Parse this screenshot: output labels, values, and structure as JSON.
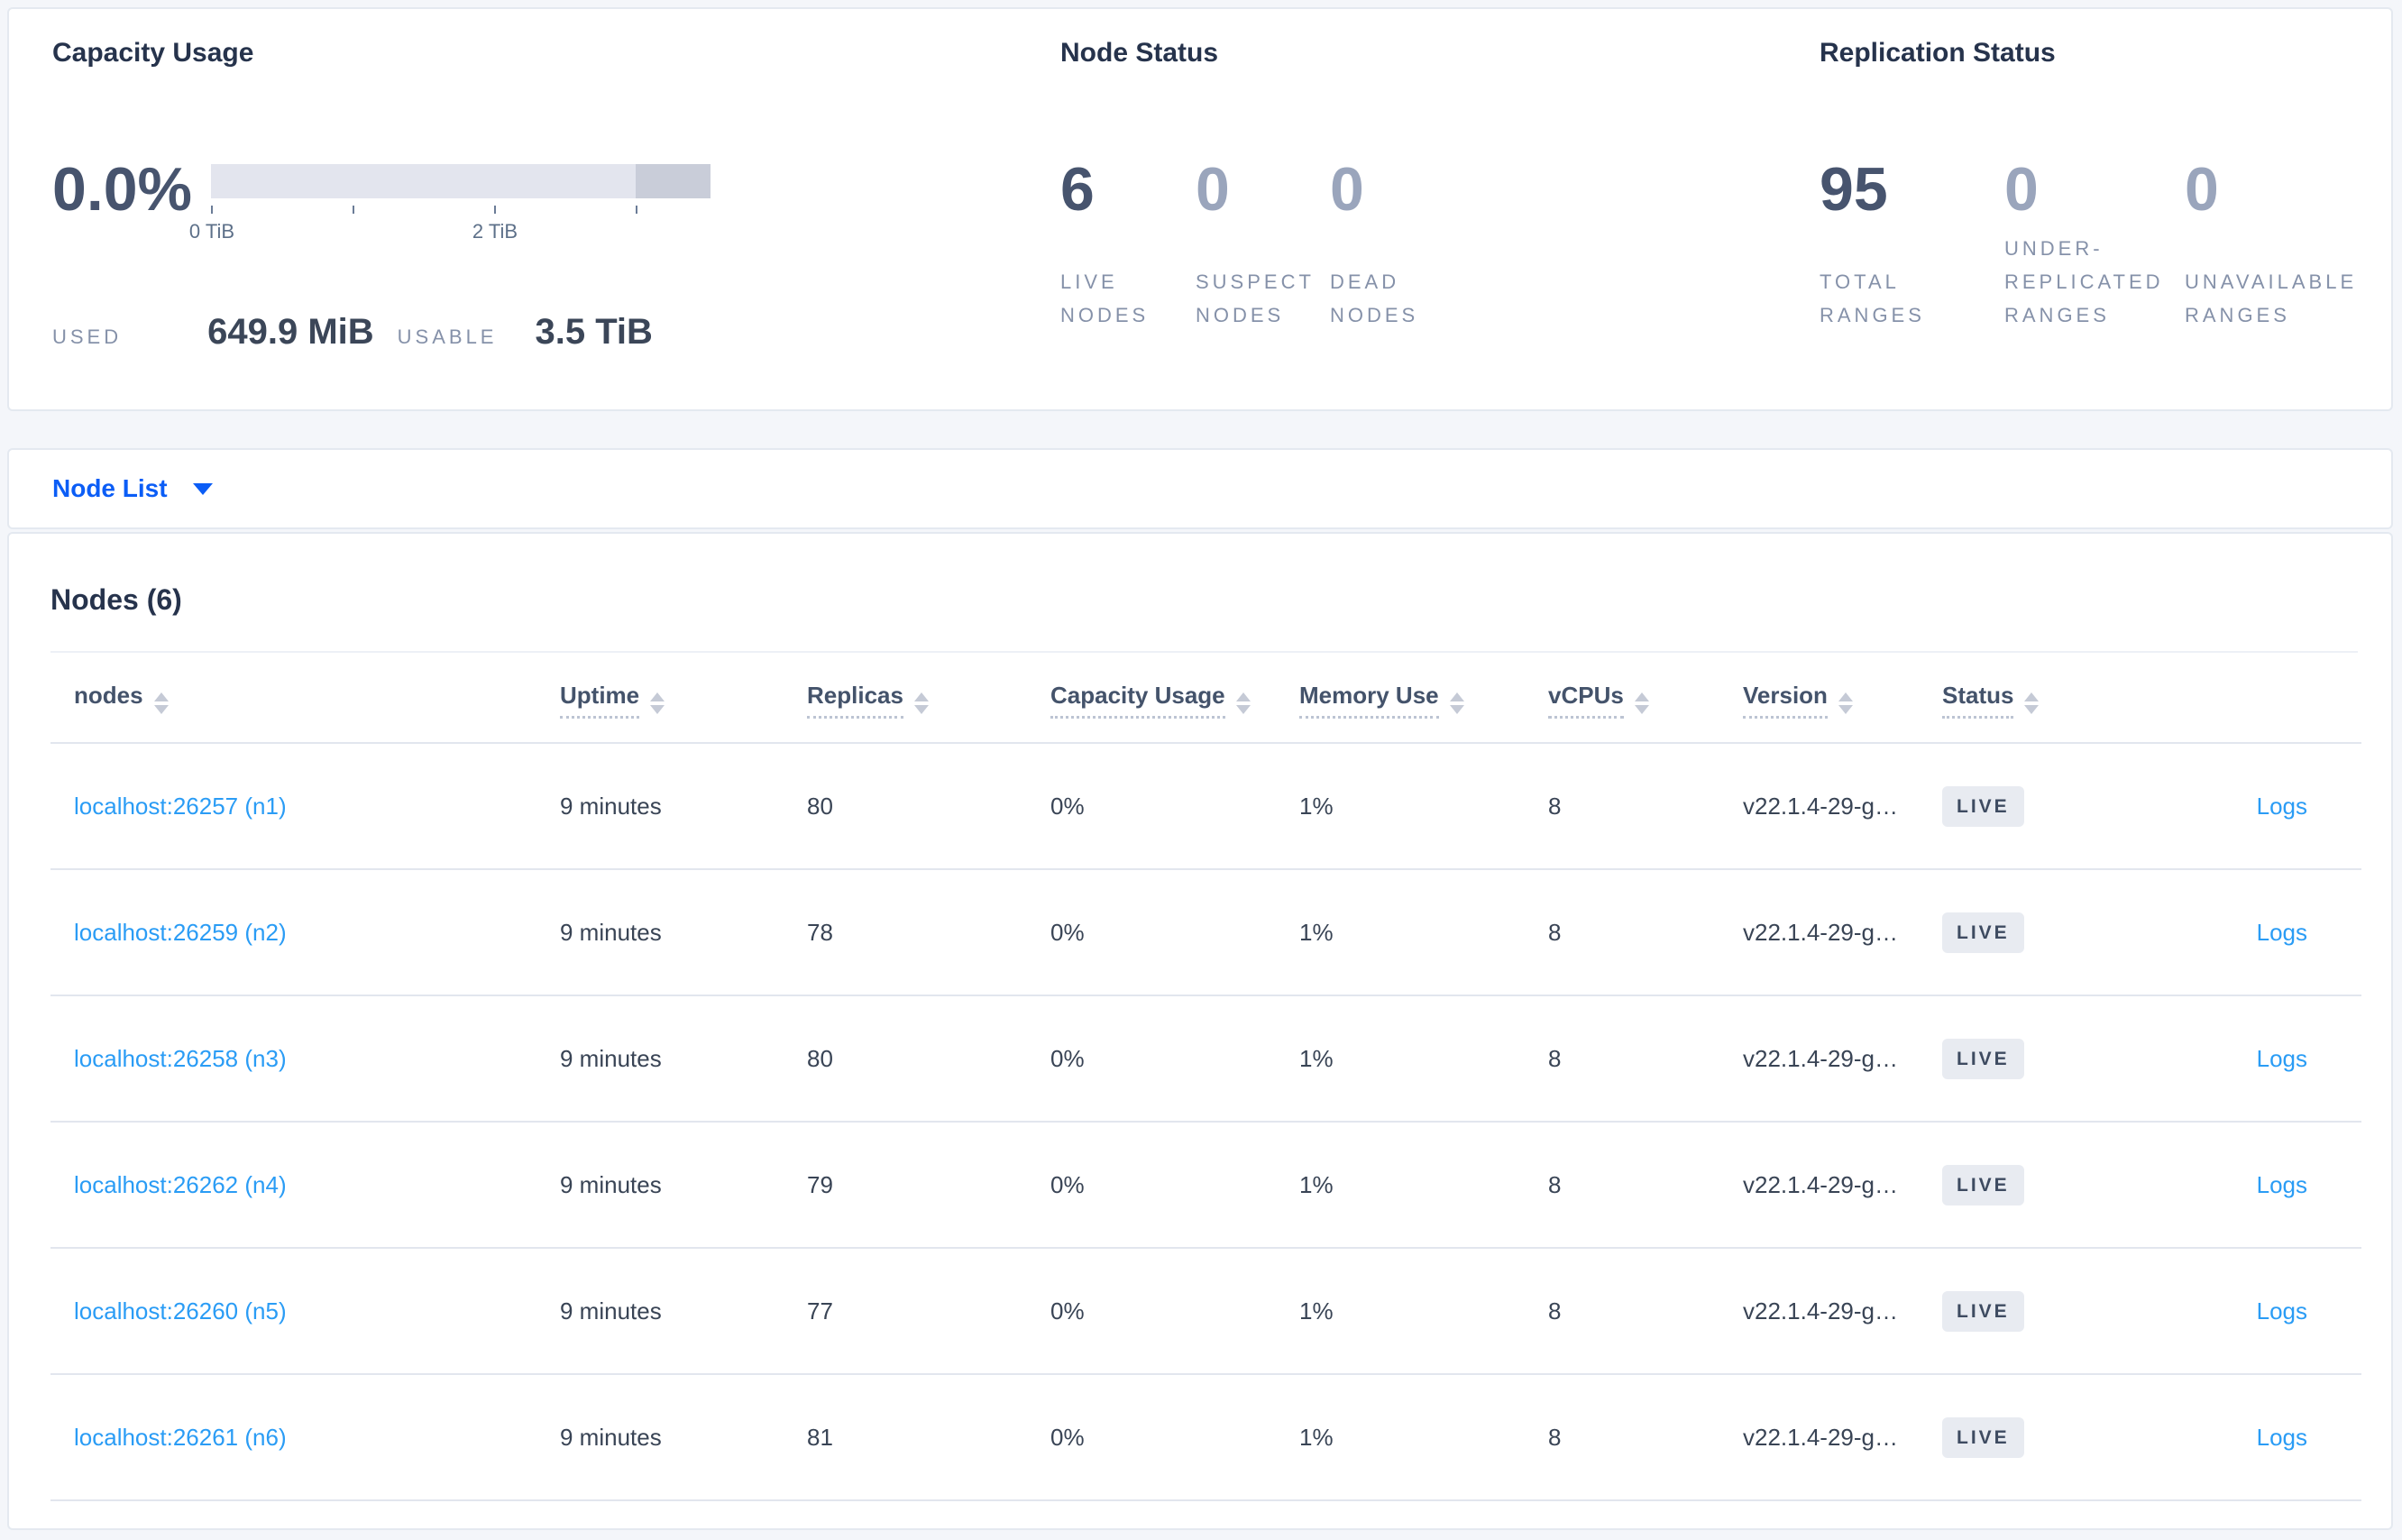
{
  "summary": {
    "capacity": {
      "title": "Capacity Usage",
      "percent": "0.0%",
      "axis_ticks": [
        "0 TiB",
        "2 TiB"
      ],
      "used_label": "USED",
      "used_value": "649.9 MiB",
      "usable_label": "USABLE",
      "usable_value": "3.5 TiB"
    },
    "node_status": {
      "title": "Node Status",
      "stats": [
        {
          "value": "6",
          "label": "LIVE NODES"
        },
        {
          "value": "0",
          "label": "SUSPECT NODES"
        },
        {
          "value": "0",
          "label": "DEAD NODES"
        }
      ]
    },
    "replication": {
      "title": "Replication Status",
      "stats": [
        {
          "value": "95",
          "label": "TOTAL RANGES"
        },
        {
          "value": "0",
          "label": "UNDER-REPLICATED RANGES"
        },
        {
          "value": "0",
          "label": "UNAVAILABLE RANGES"
        }
      ]
    }
  },
  "node_list": {
    "selector_label": "Node List"
  },
  "nodes_table": {
    "title": "Nodes (6)",
    "columns": [
      {
        "label": "nodes"
      },
      {
        "label": "Uptime"
      },
      {
        "label": "Replicas"
      },
      {
        "label": "Capacity Usage"
      },
      {
        "label": "Memory Use"
      },
      {
        "label": "vCPUs"
      },
      {
        "label": "Version"
      },
      {
        "label": "Status"
      }
    ],
    "rows": [
      {
        "node": "localhost:26257 (n1)",
        "uptime": "9 minutes",
        "replicas": "80",
        "capacity": "0%",
        "memory": "1%",
        "vcpus": "8",
        "version": "v22.1.4-29-g…",
        "status": "LIVE",
        "logs": "Logs"
      },
      {
        "node": "localhost:26259 (n2)",
        "uptime": "9 minutes",
        "replicas": "78",
        "capacity": "0%",
        "memory": "1%",
        "vcpus": "8",
        "version": "v22.1.4-29-g…",
        "status": "LIVE",
        "logs": "Logs"
      },
      {
        "node": "localhost:26258 (n3)",
        "uptime": "9 minutes",
        "replicas": "80",
        "capacity": "0%",
        "memory": "1%",
        "vcpus": "8",
        "version": "v22.1.4-29-g…",
        "status": "LIVE",
        "logs": "Logs"
      },
      {
        "node": "localhost:26262 (n4)",
        "uptime": "9 minutes",
        "replicas": "79",
        "capacity": "0%",
        "memory": "1%",
        "vcpus": "8",
        "version": "v22.1.4-29-g…",
        "status": "LIVE",
        "logs": "Logs"
      },
      {
        "node": "localhost:26260 (n5)",
        "uptime": "9 minutes",
        "replicas": "77",
        "capacity": "0%",
        "memory": "1%",
        "vcpus": "8",
        "version": "v22.1.4-29-g…",
        "status": "LIVE",
        "logs": "Logs"
      },
      {
        "node": "localhost:26261 (n6)",
        "uptime": "9 minutes",
        "replicas": "81",
        "capacity": "0%",
        "memory": "1%",
        "vcpus": "8",
        "version": "v22.1.4-29-g…",
        "status": "LIVE",
        "logs": "Logs"
      }
    ]
  },
  "colors": {
    "accent_blue": "#0b5df6",
    "link_blue": "#2a9cf5",
    "stat_dark": "#47546e",
    "stat_muted": "#9aa5bc",
    "bar_light": "#e3e5ee",
    "bar_dark": "#c9cdd9",
    "badge_bg": "#e8ebf1"
  }
}
